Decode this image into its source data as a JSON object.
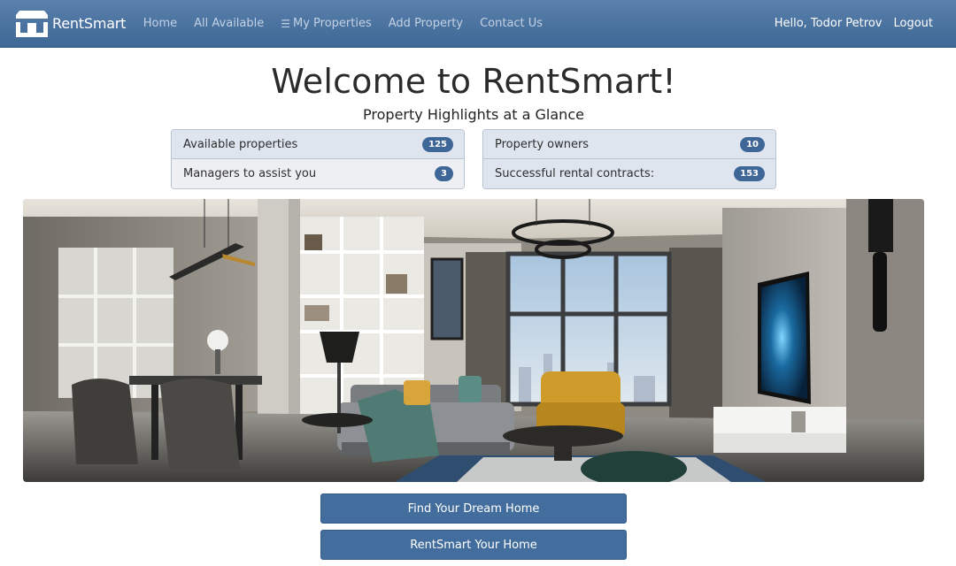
{
  "navbar": {
    "brand": "RentSmart",
    "links": [
      {
        "label": "Home",
        "icon": null
      },
      {
        "label": "All Available",
        "icon": null
      },
      {
        "label": "My Properties",
        "icon": "list-check-icon"
      },
      {
        "label": "Add Property",
        "icon": null
      },
      {
        "label": "Contact Us",
        "icon": null
      }
    ],
    "greeting": "Hello, Todor Petrov",
    "logout": "Logout"
  },
  "main": {
    "title": "Welcome to RentSmart!",
    "subtitle": "Property Highlights at a Glance",
    "stats": {
      "left": [
        {
          "label": "Available properties",
          "value": "125"
        },
        {
          "label": "Managers to assist you",
          "value": "3"
        }
      ],
      "right": [
        {
          "label": "Property owners",
          "value": "10"
        },
        {
          "label": "Successful rental contracts:",
          "value": "153"
        }
      ]
    },
    "buttons": {
      "find": "Find Your Dream Home",
      "rent": "RentSmart Your Home"
    }
  },
  "colors": {
    "navbar": "#4a74a2",
    "accent": "#436d9c",
    "badge": "#3e6798"
  }
}
